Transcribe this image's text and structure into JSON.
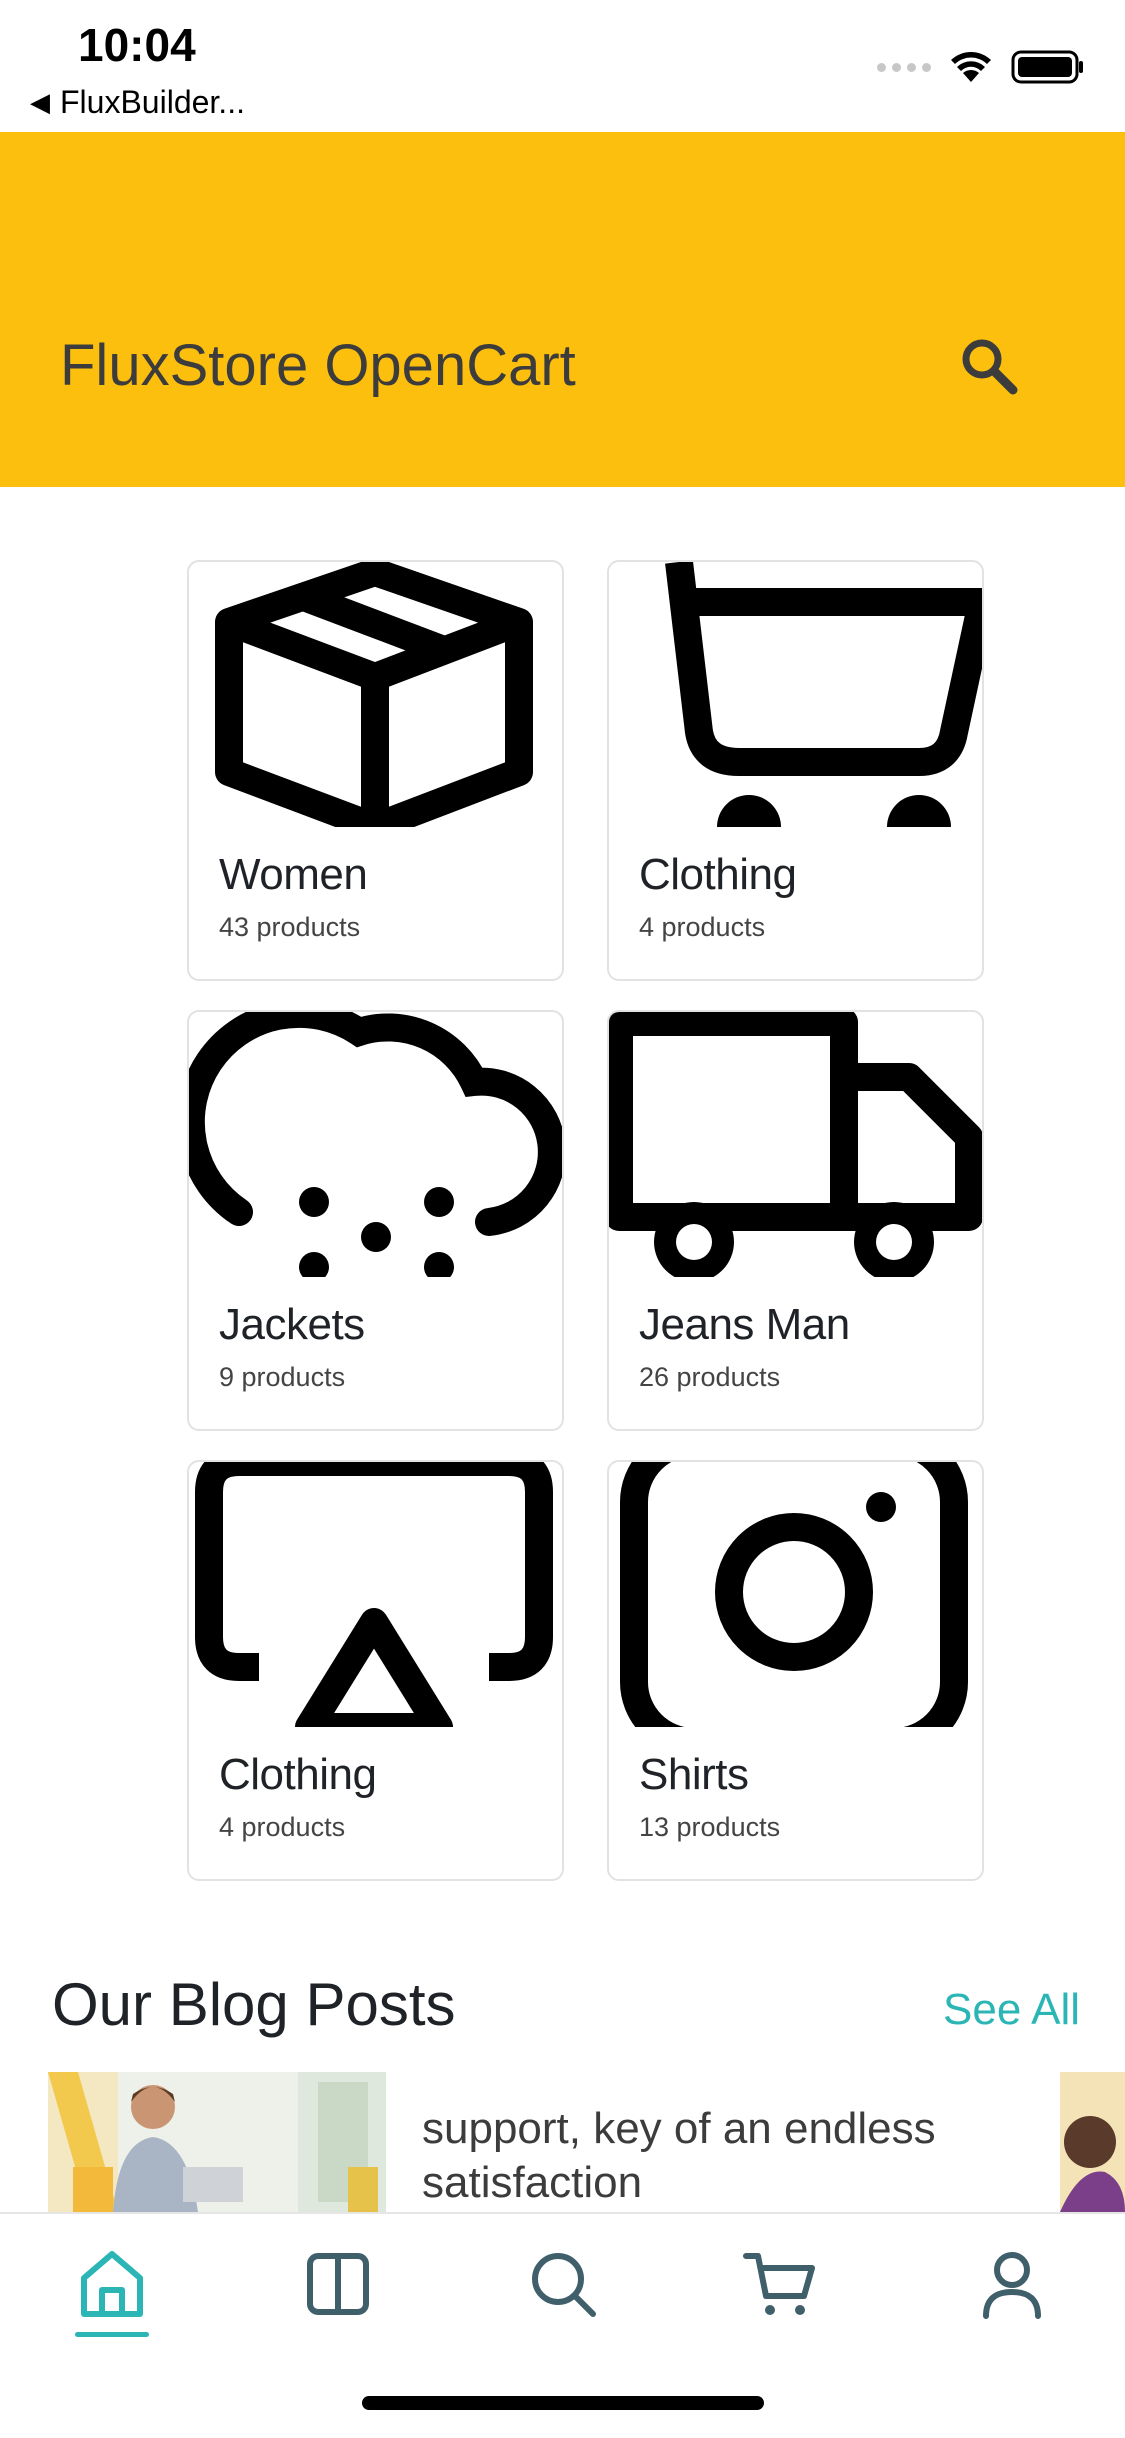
{
  "status_bar": {
    "time": "10:04",
    "back_app": "FluxBuilder..."
  },
  "app_bar": {
    "title": "FluxStore OpenCart",
    "background": "#FDBF0D"
  },
  "categories": [
    {
      "name": "Women",
      "count": "43 products",
      "icon": "package-box-icon"
    },
    {
      "name": "Clothing",
      "count": "4 products",
      "icon": "shopping-cart-icon"
    },
    {
      "name": "Jackets",
      "count": "9 products",
      "icon": "cloud-snow-icon"
    },
    {
      "name": "Jeans Man",
      "count": "26 products",
      "icon": "truck-icon"
    },
    {
      "name": "Clothing",
      "count": "4 products",
      "icon": "airplay-icon"
    },
    {
      "name": "Shirts",
      "count": "13 products",
      "icon": "instagram-camera-icon"
    }
  ],
  "blog": {
    "title": "Our Blog Posts",
    "see_all": "See All",
    "posts": [
      {
        "title": "support, key of an endless satisfaction"
      }
    ]
  },
  "bottom_nav": {
    "active": "home",
    "items": [
      "home-icon",
      "columns-icon",
      "search-icon",
      "cart-icon",
      "user-icon"
    ],
    "accent": "#2BB5B5",
    "inactive_color": "#3F5F6B"
  }
}
